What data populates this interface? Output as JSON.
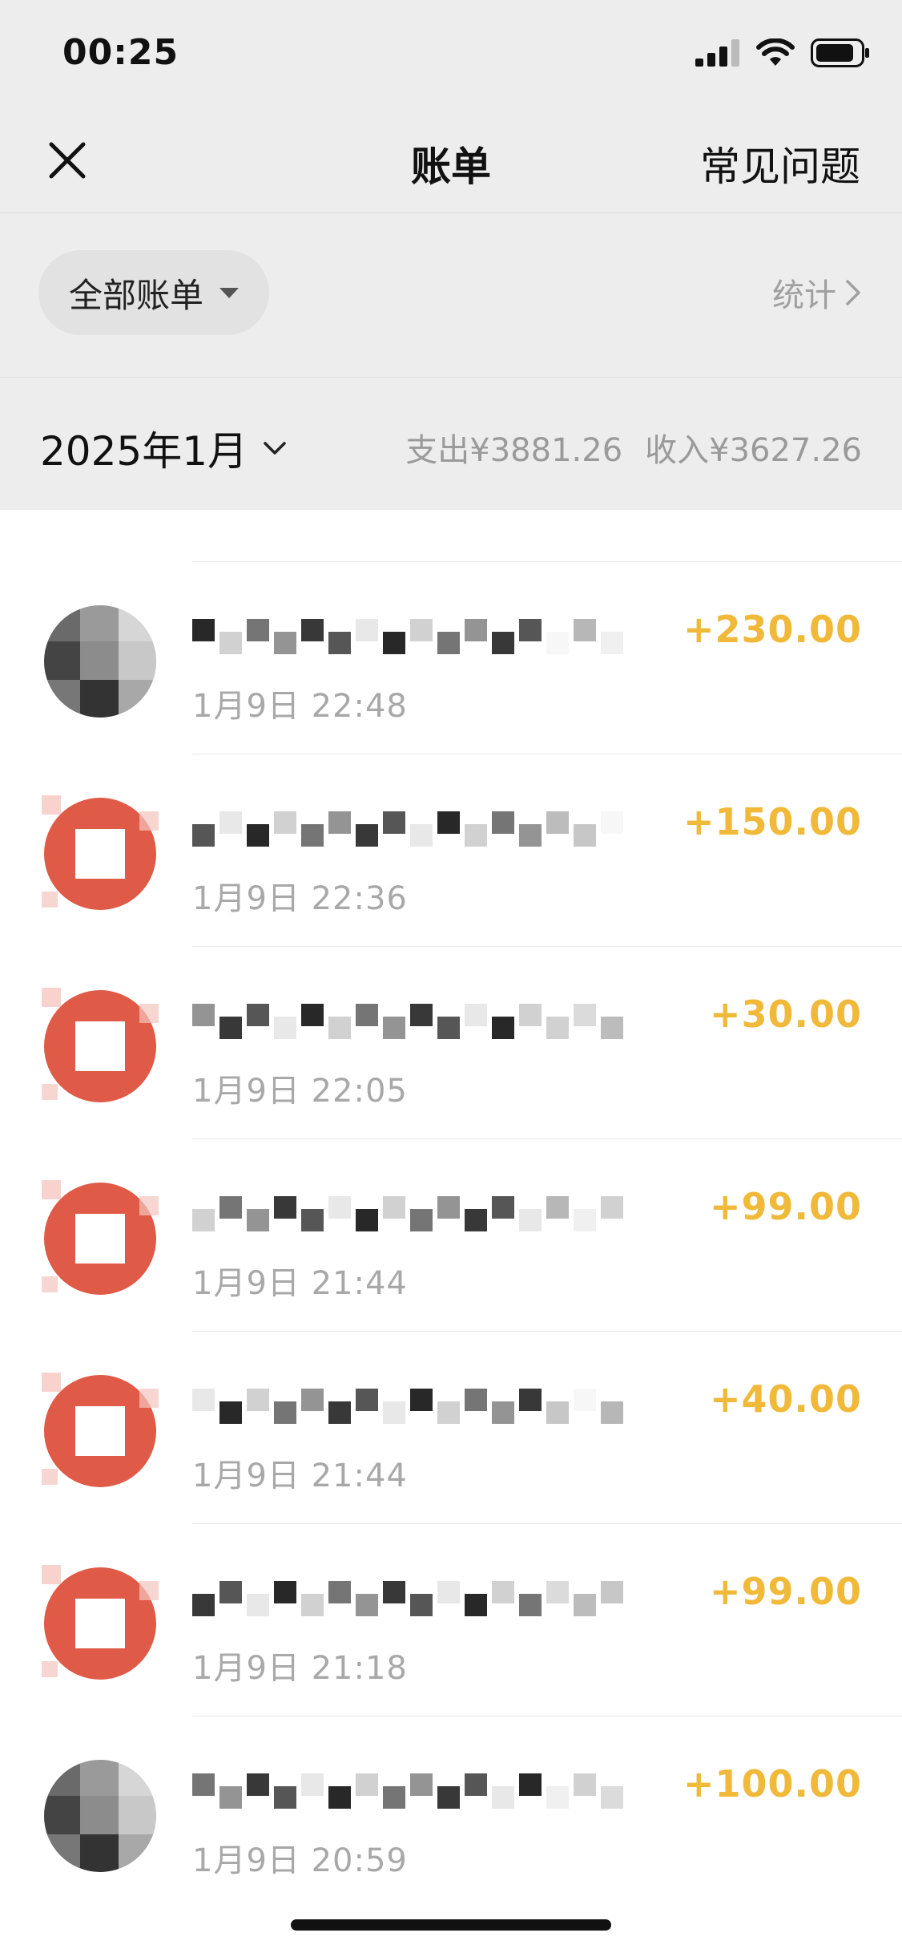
{
  "status_bar": {
    "time": "00:25",
    "signal_icon": "cellular-signal-icon",
    "wifi_icon": "wifi-icon",
    "battery_icon": "battery-icon"
  },
  "nav": {
    "close_icon": "close-icon",
    "title": "账单",
    "faq_label": "常见问题"
  },
  "filter": {
    "selected_label": "全部账单",
    "stats_label": "统计"
  },
  "month_header": {
    "month_label": "2025年1月",
    "expense_text": "支出¥3881.26",
    "income_text": "收入¥3627.26"
  },
  "colors": {
    "amount": "#f0b93a",
    "avatar_red": "#e05a48",
    "header_bg": "#ededed"
  },
  "transactions": [
    {
      "time": "1月9日 22:48",
      "amount": "+230.00",
      "avatar": "photo"
    },
    {
      "time": "1月9日 22:36",
      "amount": "+150.00",
      "avatar": "red-app"
    },
    {
      "time": "1月9日 22:05",
      "amount": "+30.00",
      "avatar": "red-app"
    },
    {
      "time": "1月9日 21:44",
      "amount": "+99.00",
      "avatar": "red-app"
    },
    {
      "time": "1月9日 21:44",
      "amount": "+40.00",
      "avatar": "red-app"
    },
    {
      "time": "1月9日 21:18",
      "amount": "+99.00",
      "avatar": "red-app"
    },
    {
      "time": "1月9日 20:59",
      "amount": "+100.00",
      "avatar": "photo"
    }
  ]
}
